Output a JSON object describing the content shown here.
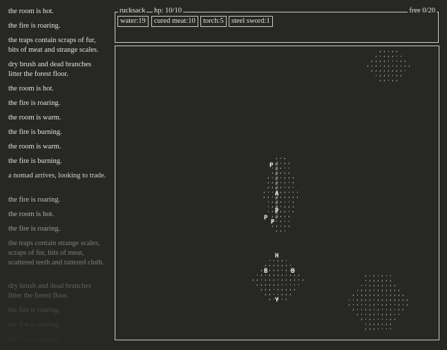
{
  "log": [
    {
      "text": "the room is hot.",
      "opacity": 1
    },
    {
      "text": "the fire is roaring.",
      "opacity": 1
    },
    {
      "text": "the traps contain scraps of fur, bits of meat and strange scales.",
      "opacity": 1
    },
    {
      "text": "dry brush and dead branches litter the forest floor.",
      "opacity": 1
    },
    {
      "text": "the room is hot.",
      "opacity": 1
    },
    {
      "text": "the fire is roaring.",
      "opacity": 1
    },
    {
      "text": "the room is warm.",
      "opacity": 1
    },
    {
      "text": "the fire is burning.",
      "opacity": 1
    },
    {
      "text": "the room is warm.",
      "opacity": 1
    },
    {
      "text": "the fire is burning.",
      "opacity": 1
    },
    {
      "text": "a nomad arrives, looking to trade.",
      "opacity": 0.9
    },
    {
      "text": "the fire is roaring.",
      "opacity": 0.8
    },
    {
      "text": "the room is hot.",
      "opacity": 0.7
    },
    {
      "text": "the fire is roaring.",
      "opacity": 0.6
    },
    {
      "text": "the traps contain strange scales, scraps of fur, bits of meat, scattered teeth and tattered cloth.",
      "opacity": 0.45
    },
    {
      "text": "dry brush and dead branches litter the forest floor.",
      "opacity": 0.3
    },
    {
      "text": "the fire is roaring.",
      "opacity": 0.18
    },
    {
      "text": "the fire is roaring.",
      "opacity": 0.1
    },
    {
      "text": "the fire is roaring.",
      "opacity": 0.04
    }
  ],
  "rucksack": {
    "title": "rucksack",
    "hp": "hp: 10/10",
    "free": "free 0/20",
    "items": [
      {
        "label": "water:19"
      },
      {
        "label": "cured meat:10"
      },
      {
        "label": "torch:5"
      },
      {
        "label": "steel sword:1"
      }
    ]
  },
  "map": {
    "tiles_grass": ",",
    "tiles_dot": ".",
    "tiles_road": "#",
    "landmarks": [
      {
        "char": "P",
        "kind": "outpost"
      },
      {
        "char": "A",
        "kind": "village"
      },
      {
        "char": "P",
        "kind": "outpost"
      },
      {
        "char": "P",
        "kind": "outpost"
      },
      {
        "char": "P",
        "kind": "outpost"
      },
      {
        "char": "H",
        "kind": "house"
      },
      {
        "char": "B",
        "kind": "borehole"
      },
      {
        "char": "B",
        "kind": "borehole"
      },
      {
        "char": "Y",
        "kind": "wanderer"
      }
    ]
  }
}
